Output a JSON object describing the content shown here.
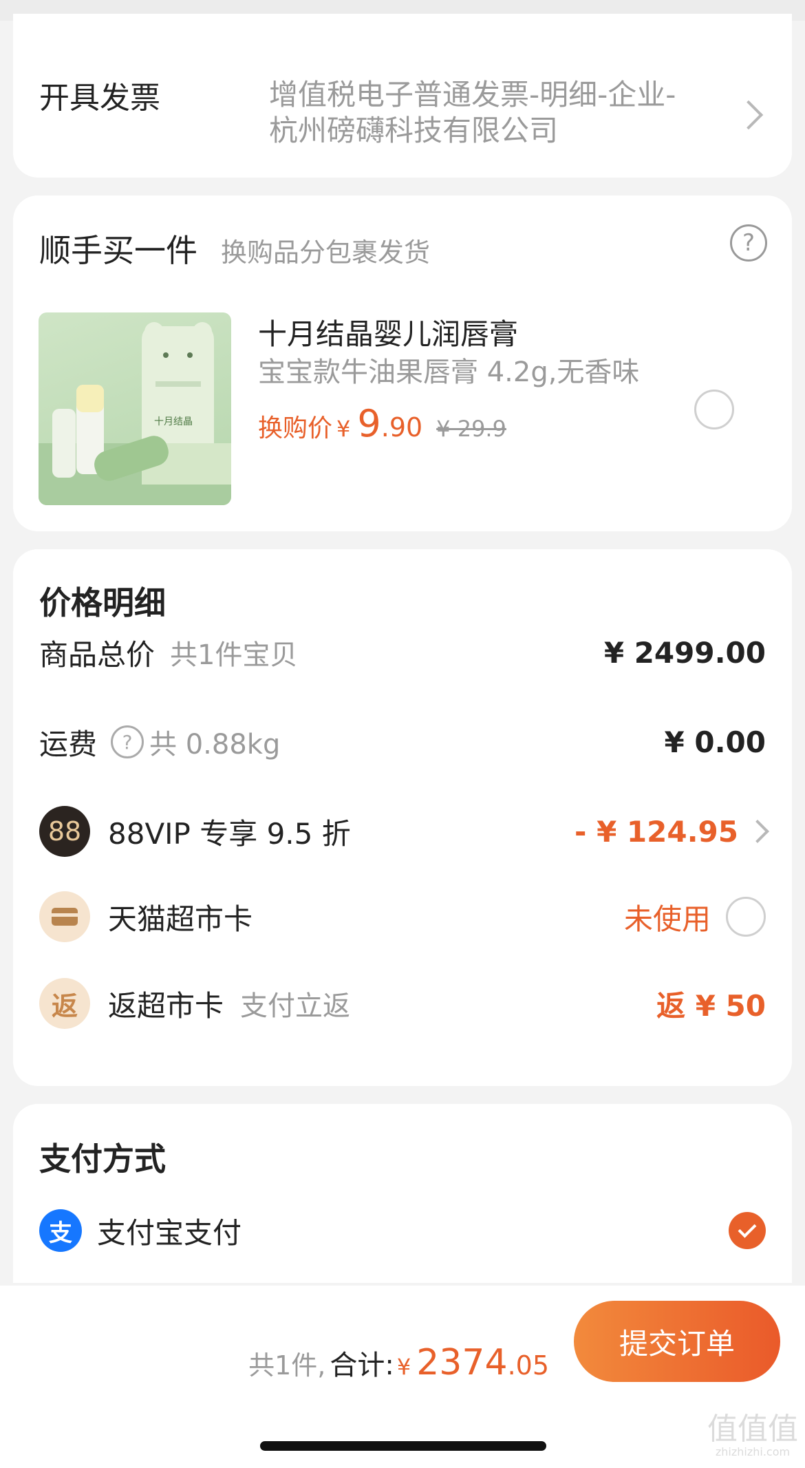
{
  "invoice": {
    "label": "开具发票",
    "value_line1": "增值税电子普通发票-明细-企业-",
    "value_line2": "杭州磅礴科技有限公司"
  },
  "addon": {
    "title": "顺手买一件",
    "subtitle": "换购品分包裹发货",
    "product": {
      "name": "十月结晶婴儿润唇膏",
      "spec": "宝宝款牛油果唇膏 4.2g,无香味",
      "price_label": "换购价",
      "currency": "¥",
      "price_int": "9",
      "price_dec": ".90",
      "original_price": "¥ 29.9",
      "box_brand": "十月结晶"
    }
  },
  "price_detail": {
    "title": "价格明细",
    "items_total": {
      "label": "商品总价",
      "note": "共1件宝贝",
      "value": "¥ 2499.00"
    },
    "shipping": {
      "label": "运费",
      "note": "共 0.88kg",
      "value": "¥ 0.00"
    },
    "vip": {
      "badge": "88",
      "label": "88VIP 专享 9.5 折",
      "value": "- ¥ 124.95"
    },
    "tmall_card": {
      "label": "天猫超市卡",
      "value": "未使用"
    },
    "rebate": {
      "badge": "返",
      "label": "返超市卡",
      "note": "支付立返",
      "value": "返 ¥ 50"
    }
  },
  "payment": {
    "title": "支付方式",
    "method_badge": "支",
    "method": "支付宝支付"
  },
  "footer": {
    "count": "共1件,",
    "total_label": "合计:",
    "currency": "¥",
    "total_int": "2374",
    "total_dec": ".05",
    "submit": "提交订单"
  },
  "watermark": {
    "logo": "值值值",
    "url": "zhizhizhi.com"
  },
  "colors": {
    "accent": "#e8602a",
    "alipay": "#1677ff",
    "vip_dark": "#2b2420"
  }
}
